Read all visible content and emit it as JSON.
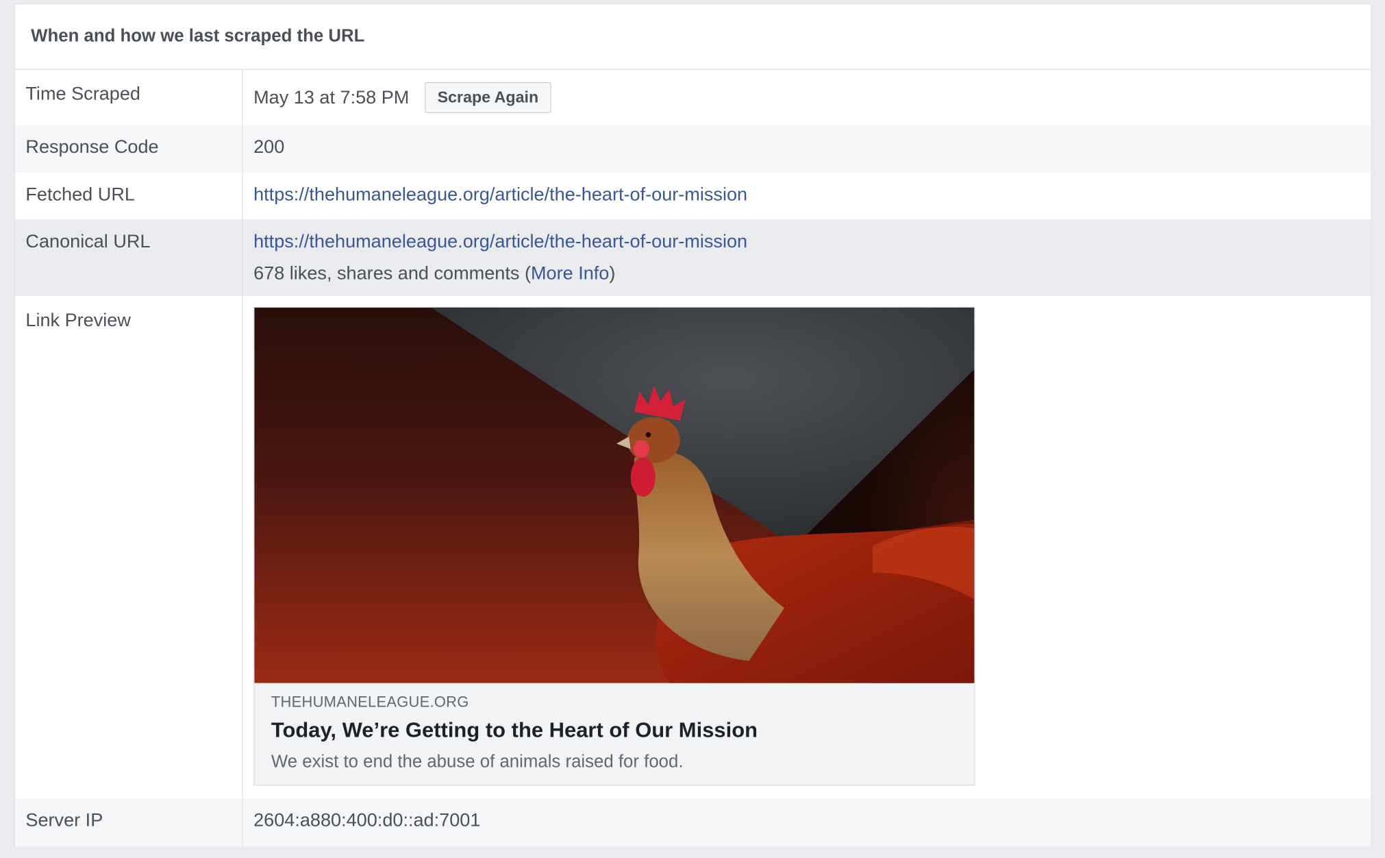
{
  "header": {
    "title": "When and how we last scraped the URL"
  },
  "rows": {
    "time_scraped": {
      "label": "Time Scraped",
      "value": "May 13 at 7:58 PM",
      "button": "Scrape Again"
    },
    "response_code": {
      "label": "Response Code",
      "value": "200"
    },
    "fetched_url": {
      "label": "Fetched URL",
      "value": "https://thehumaneleague.org/article/the-heart-of-our-mission"
    },
    "canonical_url": {
      "label": "Canonical URL",
      "value": "https://thehumaneleague.org/article/the-heart-of-our-mission",
      "engagement_prefix": "678 likes, shares and comments (",
      "more_info": "More Info",
      "engagement_suffix": ")"
    },
    "link_preview": {
      "label": "Link Preview",
      "domain": "THEHUMANELEAGUE.ORG",
      "title": "Today, We’re Getting to the Heart of Our Mission",
      "description": "We exist to end the abuse of animals raised for food."
    },
    "server_ip": {
      "label": "Server IP",
      "value": "2604:a880:400:d0::ad:7001"
    }
  },
  "colors": {
    "link": "#365899",
    "row_alt": "#f5f6f7",
    "row_highlight": "#e9ebee",
    "border": "#dddfe2"
  }
}
